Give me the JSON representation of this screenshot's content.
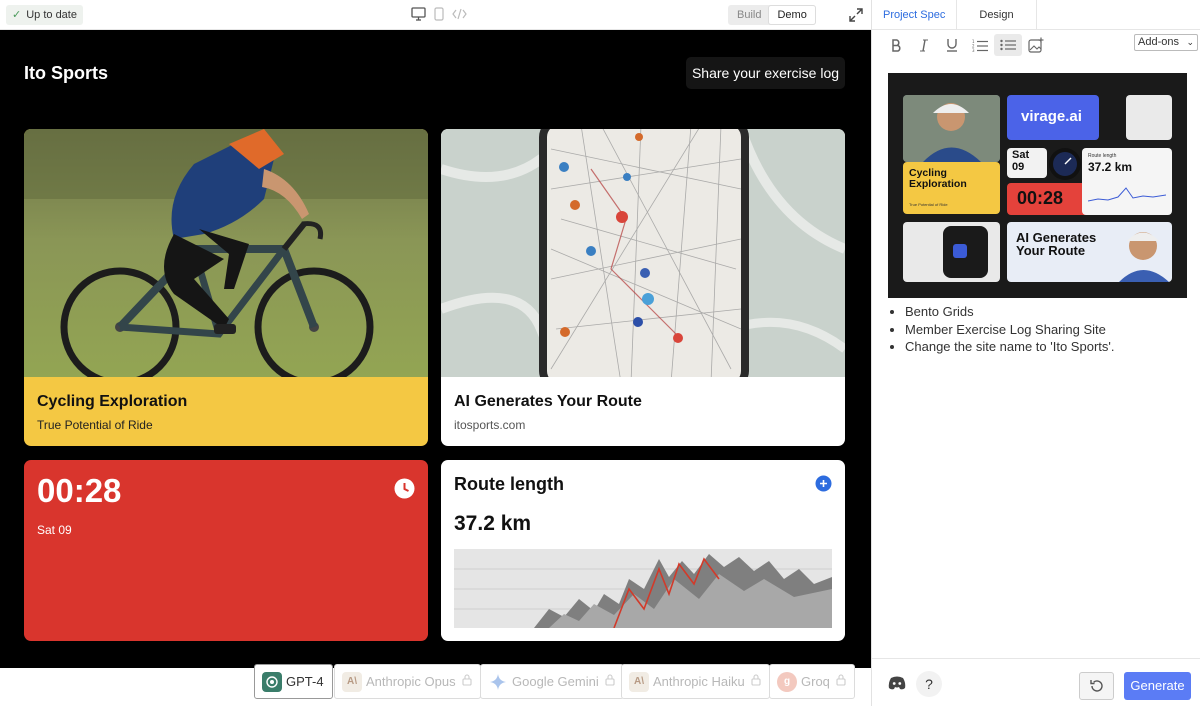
{
  "toolbar": {
    "status": "Up to date",
    "mode_build": "Build",
    "mode_demo": "Demo",
    "active_mode": "Demo"
  },
  "site": {
    "name": "Ito Sports",
    "share_button": "Share your exercise log"
  },
  "cards": {
    "cycling": {
      "title": "Cycling Exploration",
      "subtitle": "True Potential of Ride"
    },
    "route": {
      "title": "AI Generates Your Route",
      "subtitle": "itosports.com"
    },
    "timer": {
      "value": "00:28",
      "date": "Sat 09"
    },
    "length": {
      "title": "Route length",
      "value": "37.2 km"
    }
  },
  "models": [
    {
      "name": "GPT-4",
      "active": true
    },
    {
      "name": "Anthropic Opus",
      "active": false
    },
    {
      "name": "Google Gemini",
      "active": false
    },
    {
      "name": "Anthropic Haiku",
      "active": false
    },
    {
      "name": "Groq",
      "active": false
    }
  ],
  "panel": {
    "tabs": [
      "Project Spec",
      "Design"
    ],
    "active_tab": "Project Spec",
    "addons": "Add-ons",
    "spec_items": [
      "Bento Grids",
      "Member Exercise Log Sharing Site",
      "Change the site name to 'Ito Sports'."
    ],
    "generate": "Generate",
    "help": "?"
  },
  "spec_image": {
    "brand": "virage.ai",
    "date_day": "Sat",
    "date_num": "09",
    "time": "00:28",
    "route_label": "Route length",
    "route_value": "37.2 km",
    "card1_title": "Cycling Exploration",
    "card1_sub": "True Potential of Ride",
    "card2_title": "AI Generates Your Route"
  },
  "colors": {
    "yellow": "#f4c843",
    "red": "#d9352d",
    "accent_blue": "#2d6cdf",
    "generate_blue": "#5b7cf5"
  }
}
